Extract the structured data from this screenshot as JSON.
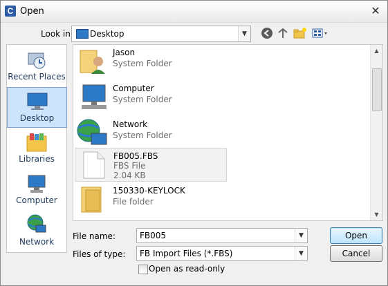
{
  "window": {
    "title": "Open",
    "close_glyph": "✕"
  },
  "toolbar": {
    "look_in_label": "Look in:",
    "look_in_value": "Desktop",
    "icons": [
      "back-icon",
      "up-folder-icon",
      "new-folder-icon",
      "view-menu-icon"
    ]
  },
  "places": [
    {
      "label": "Recent Places",
      "icon": "recent-places-icon"
    },
    {
      "label": "Desktop",
      "icon": "desktop-icon",
      "selected": true
    },
    {
      "label": "Libraries",
      "icon": "libraries-icon"
    },
    {
      "label": "Computer",
      "icon": "computer-icon"
    },
    {
      "label": "Network",
      "icon": "network-icon"
    }
  ],
  "files": [
    {
      "name": "Jason",
      "type": "System Folder",
      "icon": "user-folder-icon"
    },
    {
      "name": "Computer",
      "type": "System Folder",
      "icon": "computer-icon"
    },
    {
      "name": "Network",
      "type": "System Folder",
      "icon": "network-icon"
    },
    {
      "name": "FB005.FBS",
      "type": "FBS File",
      "size": "2.04 KB",
      "icon": "file-icon",
      "highlighted": true
    },
    {
      "name": "150330-KEYLOCK",
      "type": "File folder",
      "icon": "folder-icon"
    }
  ],
  "form": {
    "file_name_label": "File name:",
    "file_name_value": "FB005",
    "file_type_label": "Files of type:",
    "file_type_value": "FB Import Files (*.FBS)",
    "readonly_label": "Open as read-only",
    "open_label": "Open",
    "cancel_label": "Cancel"
  },
  "colors": {
    "accent": "#3c7fb1",
    "selection": "#cde4fa"
  }
}
